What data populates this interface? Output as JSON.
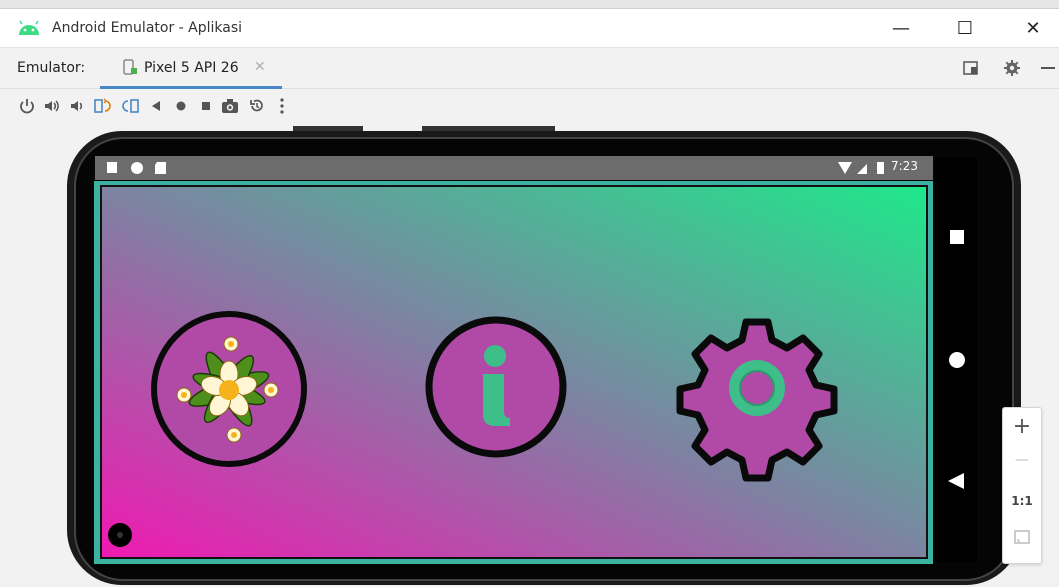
{
  "window": {
    "title": "Android Emulator - Aplikasi",
    "min": "—",
    "max": "☐",
    "close": "✕"
  },
  "tabs": {
    "label": "Emulator:",
    "device": "Pixel 5 API 26",
    "close": "✕"
  },
  "toolbar": [
    "power",
    "volume-up",
    "volume-down",
    "rotate-left",
    "rotate-right",
    "back",
    "home",
    "overview",
    "screenshot",
    "snapshot",
    "more"
  ],
  "status": {
    "time": "7:23"
  },
  "zoom": {
    "plus": "+",
    "minus": "—",
    "one_to_one": "1:1"
  },
  "colors": {
    "gradient_top_right": "#1ee88a",
    "gradient_bottom_left": "#f019b2",
    "border_teal": "#3eb2a0",
    "accent_green": "#3ebf8a",
    "icon_fill": "#b04aa6"
  }
}
